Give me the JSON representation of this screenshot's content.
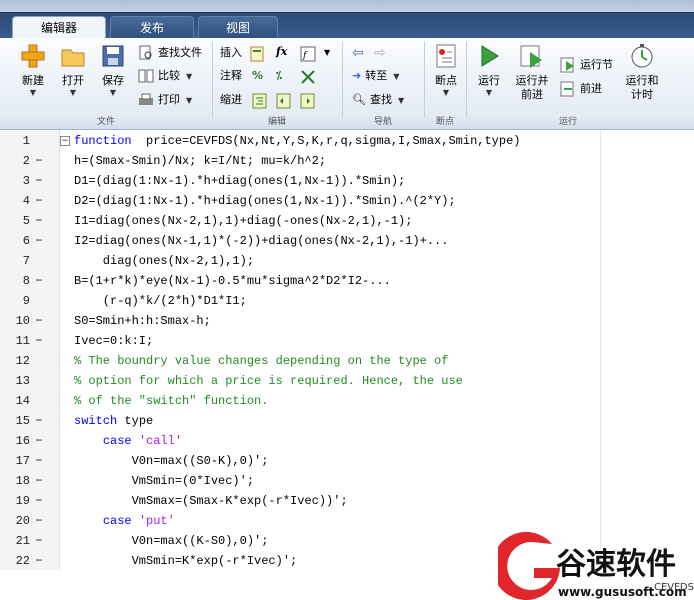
{
  "tabs": [
    {
      "label": "编辑器"
    },
    {
      "label": "发布"
    },
    {
      "label": "视图"
    }
  ],
  "ribbon": {
    "file": {
      "new_label": "新建",
      "open_label": "打开",
      "save_label": "保存",
      "find_file_label": "查找文件",
      "compare_label": "比较",
      "print_label": "打印",
      "group_label": "文件"
    },
    "edit": {
      "insert_label": "插入",
      "comment_label": "注释",
      "indent_label": "缩进",
      "fx_label": "fx",
      "group_label": "编辑"
    },
    "navigate": {
      "goto_label": "转至",
      "find_label": "查找",
      "group_label": "导航"
    },
    "breakpoints": {
      "breakpoint_label": "断点",
      "group_label": "断点"
    },
    "run": {
      "run_label": "运行",
      "run_advance_label": [
        "运行并",
        "前进"
      ],
      "run_section_label": "运行节",
      "advance_label": "前进",
      "run_time_label": [
        "运行和",
        "计时"
      ],
      "group_label": "运行"
    }
  },
  "editor": {
    "lines": [
      {
        "n": "1",
        "dash": "",
        "fold": "−",
        "seg": [
          [
            "kw",
            "function"
          ],
          [
            "",
            "  price=CEVFDS(Nx,Nt,Y,S,K,r,q,sigma,I,Smax,Smin,type)"
          ]
        ]
      },
      {
        "n": "2",
        "dash": "−",
        "fold": "",
        "seg": [
          [
            "",
            "h=(Smax-Smin)/Nx; k=I/Nt; mu=k/h^2;"
          ]
        ]
      },
      {
        "n": "3",
        "dash": "−",
        "fold": "",
        "seg": [
          [
            "",
            "D1=(diag(1:Nx-1).*h+diag(ones(1,Nx-1)).*Smin);"
          ]
        ]
      },
      {
        "n": "4",
        "dash": "−",
        "fold": "",
        "seg": [
          [
            "",
            "D2=(diag(1:Nx-1).*h+diag(ones(1,Nx-1)).*Smin).^(2*Y);"
          ]
        ]
      },
      {
        "n": "5",
        "dash": "−",
        "fold": "",
        "seg": [
          [
            "",
            "I1=diag(ones(Nx-2,1),1)+diag(-ones(Nx-2,1),-1);"
          ]
        ]
      },
      {
        "n": "6",
        "dash": "−",
        "fold": "",
        "seg": [
          [
            "",
            "I2=diag(ones(Nx-1,1)*(-2))+diag(ones(Nx-2,1),-1)+..."
          ]
        ]
      },
      {
        "n": "7",
        "dash": "",
        "fold": "",
        "seg": [
          [
            "",
            "    diag(ones(Nx-2,1),1);"
          ]
        ]
      },
      {
        "n": "8",
        "dash": "−",
        "fold": "",
        "seg": [
          [
            "",
            "B=(1+r*k)*eye(Nx-1)-0.5*mu*sigma^2*D2*I2-..."
          ]
        ]
      },
      {
        "n": "9",
        "dash": "",
        "fold": "",
        "seg": [
          [
            "",
            "    (r-q)*k/(2*h)*D1*I1;"
          ]
        ]
      },
      {
        "n": "10",
        "dash": "−",
        "fold": "",
        "seg": [
          [
            "",
            "S0=Smin+h:h:Smax-h;"
          ]
        ]
      },
      {
        "n": "11",
        "dash": "−",
        "fold": "",
        "seg": [
          [
            "",
            "Ivec=0:k:I;"
          ]
        ]
      },
      {
        "n": "12",
        "dash": "",
        "fold": "",
        "seg": [
          [
            "cm",
            "% The boundry value changes depending on the type of"
          ]
        ]
      },
      {
        "n": "13",
        "dash": "",
        "fold": "",
        "seg": [
          [
            "cm",
            "% option for which a price is required. Hence, the use"
          ]
        ]
      },
      {
        "n": "14",
        "dash": "",
        "fold": "",
        "seg": [
          [
            "cm",
            "% of the \"switch\" function."
          ]
        ]
      },
      {
        "n": "15",
        "dash": "−",
        "fold": "",
        "seg": [
          [
            "kw",
            "switch"
          ],
          [
            "",
            " type"
          ]
        ]
      },
      {
        "n": "16",
        "dash": "−",
        "fold": "",
        "seg": [
          [
            "",
            "    "
          ],
          [
            "kw",
            "case"
          ],
          [
            "",
            " "
          ],
          [
            "st",
            "'call'"
          ]
        ]
      },
      {
        "n": "17",
        "dash": "−",
        "fold": "",
        "seg": [
          [
            "",
            "        V0n=max((S0-K),0)';"
          ]
        ]
      },
      {
        "n": "18",
        "dash": "−",
        "fold": "",
        "seg": [
          [
            "",
            "        VmSmin=(0*Ivec)';"
          ]
        ]
      },
      {
        "n": "19",
        "dash": "−",
        "fold": "",
        "seg": [
          [
            "",
            "        VmSmax=(Smax-K*exp(-r*Ivec))';"
          ]
        ]
      },
      {
        "n": "20",
        "dash": "−",
        "fold": "",
        "seg": [
          [
            "",
            "    "
          ],
          [
            "kw",
            "case"
          ],
          [
            "",
            " "
          ],
          [
            "st",
            "'put'"
          ]
        ]
      },
      {
        "n": "21",
        "dash": "−",
        "fold": "",
        "seg": [
          [
            "",
            "        V0n=max((K-S0),0)';"
          ]
        ]
      },
      {
        "n": "22",
        "dash": "−",
        "fold": "",
        "seg": [
          [
            "",
            "        VmSmin=K*exp(-r*Ivec)';"
          ]
        ]
      }
    ]
  },
  "watermark": {
    "brand": "谷速软件",
    "url": "www.gususoft.com",
    "fragment": "CEVFDS"
  }
}
